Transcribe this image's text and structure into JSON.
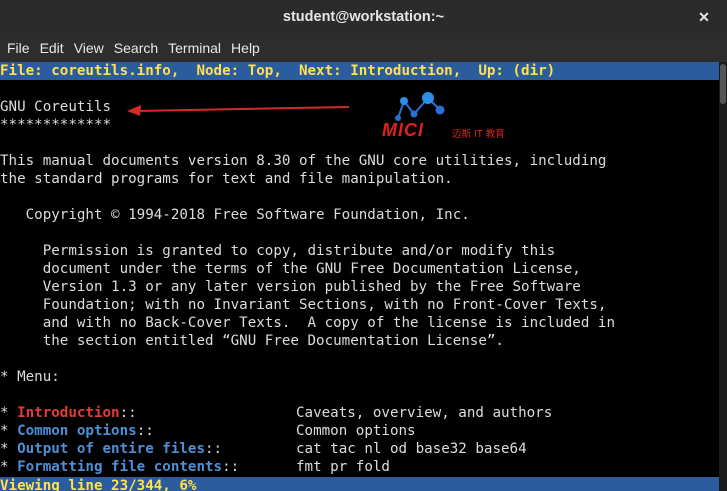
{
  "window": {
    "title": "student@workstation:~"
  },
  "menubar": [
    "File",
    "Edit",
    "View",
    "Search",
    "Terminal",
    "Help"
  ],
  "info_header": "File: coreutils.info,  Node: Top,  Next: Introduction,  Up: (dir)",
  "heading": {
    "title": "GNU Coreutils",
    "underline": "*************"
  },
  "logo": {
    "text": "MICI",
    "subtitle": "迈斯 IT 教育"
  },
  "body_lines": [
    "This manual documents version 8.30 of the GNU core utilities, including",
    "the standard programs for text and file manipulation.",
    "",
    "   Copyright © 1994-2018 Free Software Foundation, Inc.",
    "",
    "     Permission is granted to copy, distribute and/or modify this",
    "     document under the terms of the GNU Free Documentation License,",
    "     Version 1.3 or any later version published by the Free Software",
    "     Foundation; with no Invariant Sections, with no Front-Cover Texts,",
    "     and with no Back-Cover Texts.  A copy of the license is included in",
    "     the section entitled “GNU Free Documentation License”.",
    "",
    "* Menu:"
  ],
  "menu_entries": [
    {
      "name": "Introduction",
      "sep": "::",
      "desc": "Caveats, overview, and authors",
      "color": "#e53b3b"
    },
    {
      "name": "Common options",
      "sep": "::",
      "desc": "Common options",
      "color": "#4f8fd6"
    },
    {
      "name": "Output of entire files",
      "sep": "::",
      "desc": "cat tac nl od base32 base64",
      "color": "#4f8fd6"
    },
    {
      "name": "Formatting file contents",
      "sep": "::",
      "desc": "fmt pr fold",
      "color": "#4f8fd6"
    }
  ],
  "status_line": "Viewing line 23/344, 6%",
  "colors": {
    "bar_bg": "#2a5c9e",
    "bar_fg": "#ffe14d",
    "arrow": "#d42a2a"
  }
}
